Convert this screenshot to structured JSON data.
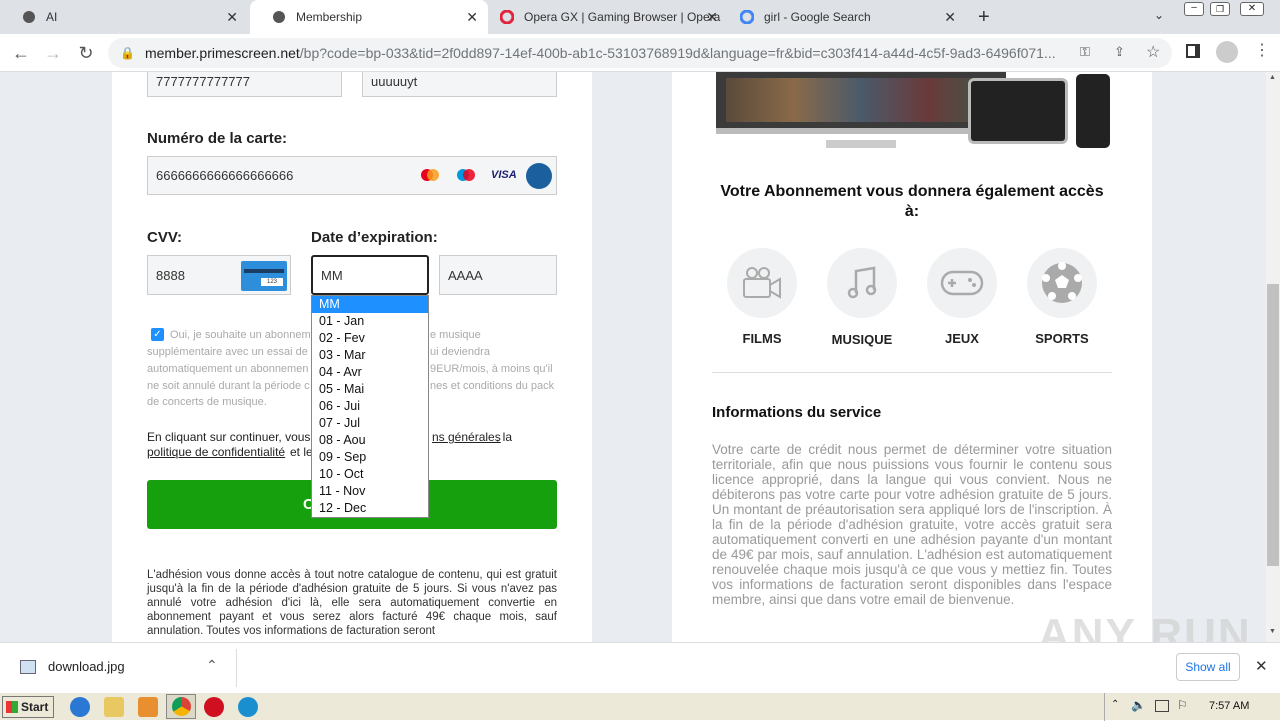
{
  "tabs": [
    {
      "label": "AI"
    },
    {
      "label": "Membership"
    },
    {
      "label": "Opera GX | Gaming Browser | Opera"
    },
    {
      "label": "girl - Google Search"
    }
  ],
  "address": {
    "host": "member.primescreen.net",
    "path": "/bp?code=bp-033&tid=2f0dd897-14ef-400b-ab1c-53103768919d&language=fr&bid=c303f414-a44d-4c5f-9ad3-6496f071..."
  },
  "form": {
    "top_left_value": "7777777777777",
    "top_right_value": "uuuuuyt",
    "card_label": "Numéro de la carte:",
    "card_value": "6666666666666666666",
    "cvv_label": "CVV:",
    "cvv_value": "8888",
    "cvv_card_num": "123",
    "exp_label": "Date d’expiration:",
    "month_value": "MM",
    "year_value": "AAAA",
    "consent_left": [
      "Oui, je souhaite un abonnem",
      "supplémentaire avec un essai de",
      "automatiquement un abonnemen",
      "ne soit annulé durant la période c",
      "de concerts de musique."
    ],
    "consent_right": [
      "e musique",
      "ui deviendra",
      "9EUR/mois, à moins qu'il",
      "nes et conditions du pack"
    ],
    "terms_a": "En cliquant sur continuer, vous",
    "terms_link1": "ns générales",
    "terms_b": ", la",
    "terms_link2": "politique de confidentialité",
    "terms_c": " et le",
    "continue_label": "C",
    "footer_text": "L'adhésion vous donne accès à tout notre catalogue de contenu, qui est gratuit jusqu'à la fin de la période d'adhésion gratuite de 5 jours. Si vous n'avez pas annulé votre adhésion d'ici là, elle sera automatiquement convertie en abonnement payant et vous serez alors facturé 49€ chaque mois, sauf annulation. Toutes vos informations de facturation seront"
  },
  "month_options": [
    "MM",
    "01 - Jan",
    "02 - Fev",
    "03 - Mar",
    "04 - Avr",
    "05 - Mai",
    "06 - Jui",
    "07 - Jul",
    "08 - Aou",
    "09 - Sep",
    "10 - Oct",
    "11 - Nov",
    "12 - Dec"
  ],
  "right": {
    "title": "Votre Abonnement vous donnera également accès à:",
    "services": [
      {
        "label": "FILMS",
        "icon": "camera-icon"
      },
      {
        "label": "MUSIQUE",
        "icon": "music-icon"
      },
      {
        "label": "JEUX",
        "icon": "gamepad-icon"
      },
      {
        "label": "SPORTS",
        "icon": "soccer-ball-icon"
      }
    ],
    "info_title": "Informations du service",
    "info_text": "Votre carte de crédit nous permet de déterminer votre situation territoriale, afin que nous puissions vous fournir le contenu sous licence approprié, dans la langue qui vous convient. Nous ne débiterons pas votre carte pour votre adhésion gratuite de 5 jours. Un montant de préautorisation sera appliqué lors de l'inscription. À la fin de la période d'adhésion gratuite, votre accès gratuit sera automatiquement converti en une adhésion payante d'un montant de 49€ par mois, sauf annulation. L'adhésion est automatiquement renouvelée chaque mois jusqu'à ce que vous y mettiez fin. Toutes vos informations de facturation seront disponibles dans l'espace membre, ainsi que dans votre email de bienvenue."
  },
  "download": {
    "file": "download.jpg",
    "show_all": "Show all"
  },
  "taskbar": {
    "start": "Start",
    "time": "7:57 AM"
  },
  "watermark": "ANY RUN",
  "colors": {
    "green": "#17a00e",
    "accent": "#1e90ff"
  }
}
